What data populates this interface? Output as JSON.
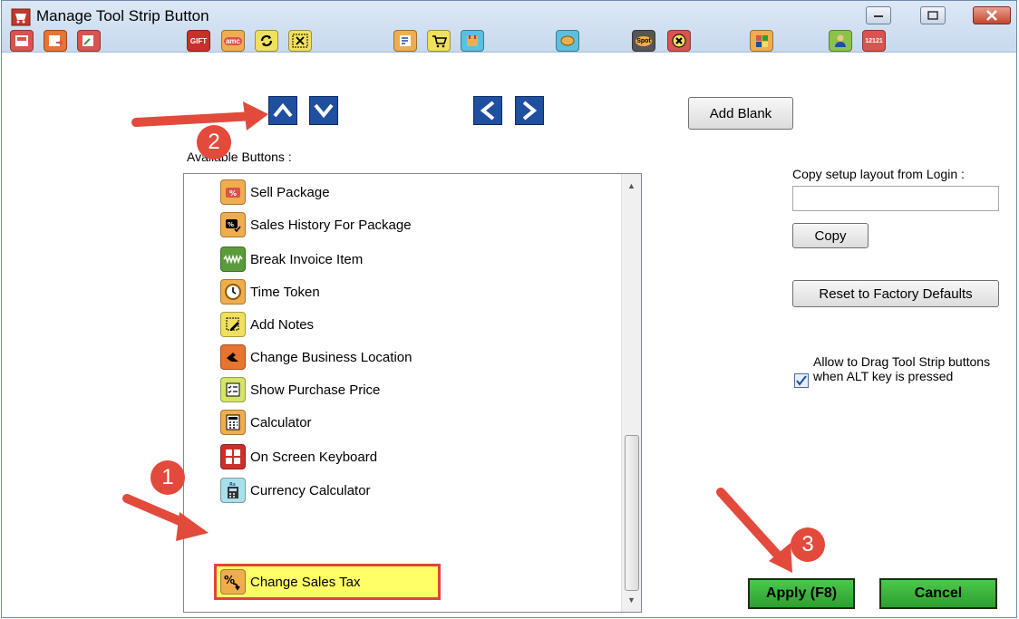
{
  "window": {
    "title": "Manage Tool Strip Button",
    "title_icon": "cart-icon",
    "controls": [
      "minimize-icon",
      "maximize-icon",
      "close-icon"
    ]
  },
  "toolstrip_icons": [
    "register-icon",
    "return-icon",
    "exchange-icon",
    "gift-card-icon",
    "amc-icon",
    "refresh-icon",
    "barcode-icon",
    "notes-icon",
    "cart-icon",
    "reports-icon",
    "money-icon",
    "spot-icon",
    "cancel-icon",
    "grid-icon",
    "customer-icon",
    "calendar-icon"
  ],
  "toolstrip_labels": {
    "gift": "GIFT",
    "amc": "amc",
    "spot": "Spot",
    "date": "12121"
  },
  "controls": {
    "add_blank_label": "Add Blank",
    "available_buttons_label": "Available Buttons :",
    "copy_from_login_label": "Copy setup layout from Login :",
    "copy_input_value": "",
    "copy_label": "Copy",
    "reset_label": "Reset to Factory Defaults",
    "allow_drag_label": "Allow to Drag Tool Strip buttons when ALT key is pressed",
    "allow_drag_checked": true,
    "apply_label": "Apply (F8)",
    "cancel_label": "Cancel"
  },
  "available_buttons": [
    {
      "label": "Sell Package",
      "icon": "package-icon"
    },
    {
      "label": "Sales History For Package",
      "icon": "package-history-icon"
    },
    {
      "label": "Break Invoice Item",
      "icon": "break-invoice-icon"
    },
    {
      "label": "Time Token",
      "icon": "clock-icon"
    },
    {
      "label": "Add Notes",
      "icon": "note-pencil-icon"
    },
    {
      "label": "Change Business Location",
      "icon": "location-icon"
    },
    {
      "label": "Show Purchase Price",
      "icon": "checklist-icon"
    },
    {
      "label": "Calculator",
      "icon": "calculator-icon"
    },
    {
      "label": "On Screen Keyboard",
      "icon": "keyboard-icon"
    },
    {
      "label": "Currency Calculator",
      "icon": "currency-calculator-icon"
    },
    {
      "label": "Change Sales Tax",
      "icon": "percent-arrow-icon",
      "selected": true
    }
  ],
  "callouts": [
    "1",
    "2",
    "3"
  ],
  "colors": {
    "callout": "#e24a3c",
    "nav_button": "#1f4f9f",
    "apply_button": "#3db83c",
    "highlight": "#ffff66"
  }
}
